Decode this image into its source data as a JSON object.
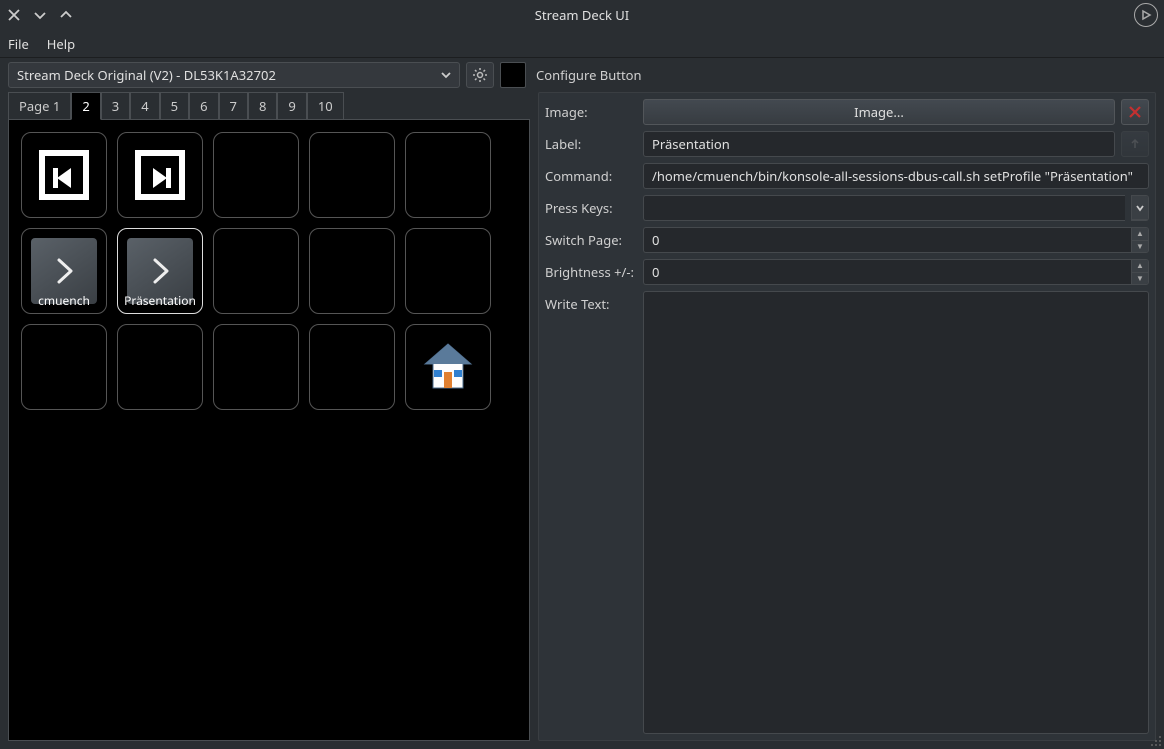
{
  "window": {
    "title": "Stream Deck UI"
  },
  "menu": {
    "file": "File",
    "help": "Help"
  },
  "device": {
    "selected": "Stream Deck Original (V2) - DL53K1A32702"
  },
  "tabs": [
    "Page 1",
    "2",
    "3",
    "4",
    "5",
    "6",
    "7",
    "8",
    "9",
    "10"
  ],
  "active_tab_index": 1,
  "deck": {
    "buttons": [
      {
        "icon": "media-prev",
        "label": ""
      },
      {
        "icon": "media-next",
        "label": ""
      },
      {
        "icon": null,
        "label": ""
      },
      {
        "icon": null,
        "label": ""
      },
      {
        "icon": null,
        "label": ""
      },
      {
        "icon": "chevron-right-dark",
        "label": "cmuench"
      },
      {
        "icon": "chevron-right-dark",
        "label": "Präsentation",
        "selected": true
      },
      {
        "icon": null,
        "label": ""
      },
      {
        "icon": null,
        "label": ""
      },
      {
        "icon": null,
        "label": ""
      },
      {
        "icon": null,
        "label": ""
      },
      {
        "icon": null,
        "label": ""
      },
      {
        "icon": null,
        "label": ""
      },
      {
        "icon": null,
        "label": ""
      },
      {
        "icon": "home",
        "label": ""
      }
    ]
  },
  "panel": {
    "header": "Configure Button",
    "image_label": "Image:",
    "image_button": "Image...",
    "label_label": "Label:",
    "label_value": "Präsentation",
    "command_label": "Command:",
    "command_value": "/home/cmuench/bin/konsole-all-sessions-dbus-call.sh setProfile \"Präsentation\"",
    "presskeys_label": "Press Keys:",
    "presskeys_value": "",
    "switchpage_label": "Switch Page:",
    "switchpage_value": "0",
    "brightness_label": "Brightness +/-:",
    "brightness_value": "0",
    "writetext_label": "Write Text:",
    "writetext_value": ""
  }
}
